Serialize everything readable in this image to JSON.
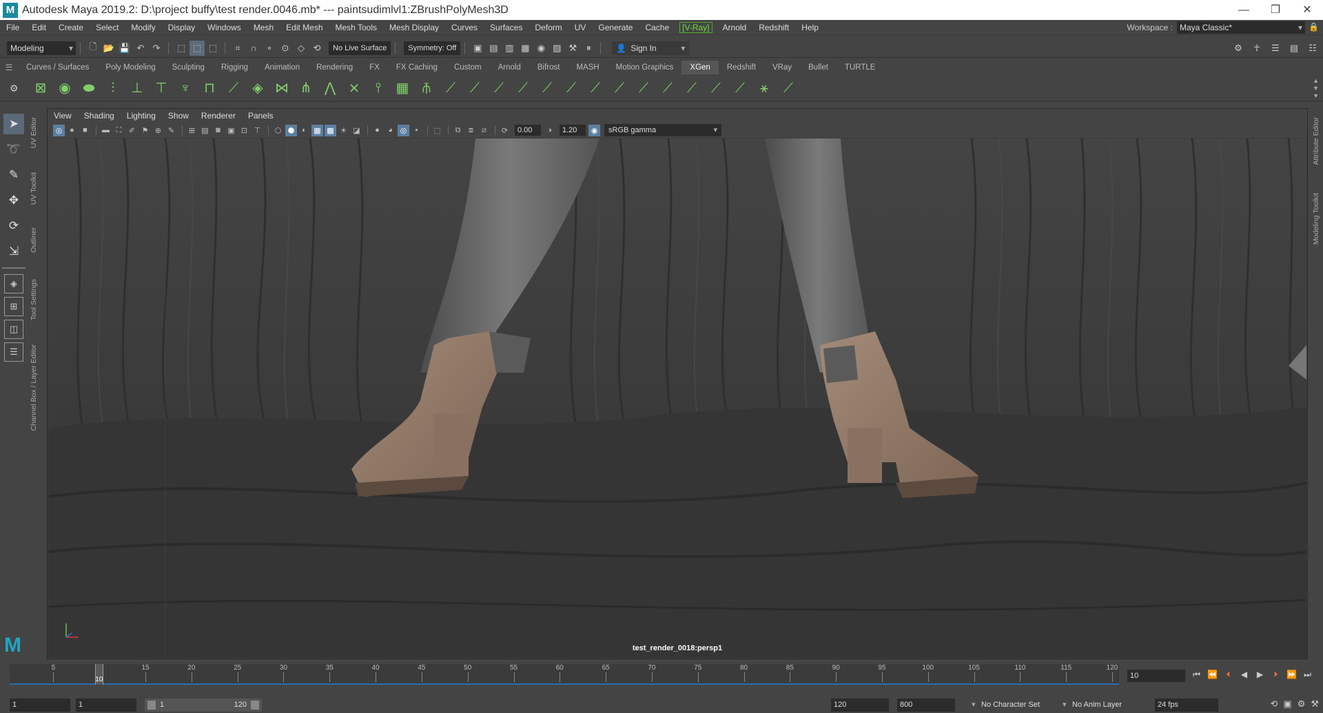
{
  "window": {
    "app_logo": "M",
    "title": "Autodesk Maya 2019.2: D:\\project buffy\\test render.0046.mb*   ---   paintsudimlvl1:ZBrushPolyMesh3D",
    "buttons": [
      "—",
      "❐",
      "✕"
    ]
  },
  "menubar": {
    "items": [
      "File",
      "Edit",
      "Create",
      "Select",
      "Modify",
      "Display",
      "Windows",
      "Mesh",
      "Edit Mesh",
      "Mesh Tools",
      "Mesh Display",
      "Curves",
      "Surfaces",
      "Deform",
      "UV",
      "Generate",
      "Cache"
    ],
    "vray": "[V-Ray]",
    "items_after": [
      "Arnold",
      "Redshift",
      "Help"
    ],
    "workspace_label": "Workspace :",
    "workspace_value": "Maya Classic*"
  },
  "statusline": {
    "menu_set": "Modeling",
    "live_surface": "No Live Surface",
    "symmetry": "Symmetry: Off",
    "sign_in": "Sign In"
  },
  "shelf": {
    "tabs": [
      "Curves / Surfaces",
      "Poly Modeling",
      "Sculpting",
      "Rigging",
      "Animation",
      "Rendering",
      "FX",
      "FX Caching",
      "Custom",
      "Arnold",
      "Bifrost",
      "MASH",
      "Motion Graphics",
      "XGen",
      "Redshift",
      "VRay",
      "Bullet",
      "TURTLE"
    ],
    "active_tab": "XGen",
    "icon_count_label": ""
  },
  "toolbox": {
    "tools": [
      "select-tool-icon",
      "lasso-tool-icon",
      "paint-select-icon",
      "move-tool-icon",
      "rotate-tool-icon",
      "scale-tool-icon"
    ]
  },
  "side_tabs_left": [
    "UV Editor",
    "UV Toolkit",
    "Outliner",
    "Tool Settings",
    "Channel Box / Layer Editor"
  ],
  "side_tabs_right": [
    "Attribute Editor",
    "Modeling Toolkit"
  ],
  "panel": {
    "menu": [
      "View",
      "Shading",
      "Lighting",
      "Show",
      "Renderer",
      "Panels"
    ],
    "exposure": "0.00",
    "gamma": "1.20",
    "color_space": "sRGB gamma",
    "camera_label": "test_render_0018:persp1",
    "axis_y": "y",
    "axis_x": "x"
  },
  "timeslider": {
    "ticks": [
      "5",
      "10",
      "15",
      "20",
      "25",
      "30",
      "35",
      "40",
      "45",
      "50",
      "55",
      "60",
      "65",
      "70",
      "75",
      "80",
      "85",
      "90",
      "95",
      "100",
      "105",
      "110",
      "115",
      "120"
    ],
    "current_frame": "10",
    "current_frame_field": "10"
  },
  "rangebar": {
    "start": "1",
    "playback_start": "1",
    "slider_start": "1",
    "slider_end": "120",
    "playback_end": "120",
    "end": "800",
    "character_set": "No Character Set",
    "anim_layer": "No Anim Layer",
    "fps": "24 fps"
  },
  "colors": {
    "accent": "#2a6fb0",
    "vray": "#6fdc3c",
    "shelf_icon": "#7fd06a",
    "boot": "#8e7565"
  }
}
